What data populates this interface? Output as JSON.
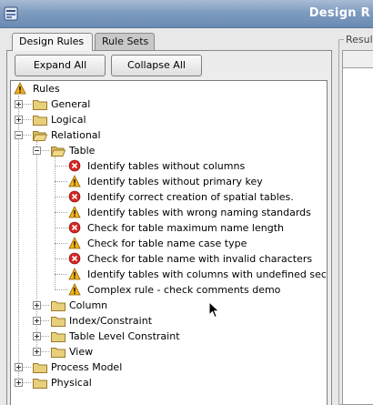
{
  "window": {
    "title": "Design R"
  },
  "tabs": [
    {
      "label": "Design Rules",
      "active": true
    },
    {
      "label": "Rule Sets",
      "active": false
    }
  ],
  "buttons": {
    "expand_all": "Expand All",
    "collapse_all": "Collapse All"
  },
  "results": {
    "label": "Result"
  },
  "tree": {
    "root": {
      "label": "Rules",
      "icon": "warning-icon"
    },
    "general": "General",
    "logical": "Logical",
    "relational": "Relational",
    "table": "Table",
    "rules": [
      {
        "label": "Identify tables without columns",
        "status": "error"
      },
      {
        "label": "Identify tables without primary key",
        "status": "warning"
      },
      {
        "label": "Identify correct creation of spatial tables.",
        "status": "error"
      },
      {
        "label": "Identify tables with wrong naming standards",
        "status": "warning"
      },
      {
        "label": "Check for table maximum name length",
        "status": "error"
      },
      {
        "label": "Check for table name case type",
        "status": "warning"
      },
      {
        "label": "Check for table name with invalid characters",
        "status": "error"
      },
      {
        "label": "Identify tables with columns with undefined secu",
        "status": "warning"
      },
      {
        "label": "Complex rule - check comments demo",
        "status": "warning"
      }
    ],
    "column": "Column",
    "index_constraint": "Index/Constraint",
    "table_level_constraint": "Table Level Constraint",
    "view": "View",
    "process_model": "Process Model",
    "physical": "Physical"
  },
  "colors": {
    "error": "#d62424",
    "warning": "#f2b21a",
    "folder": "#e8cf7a",
    "titlebar": "#6a8ab2"
  }
}
